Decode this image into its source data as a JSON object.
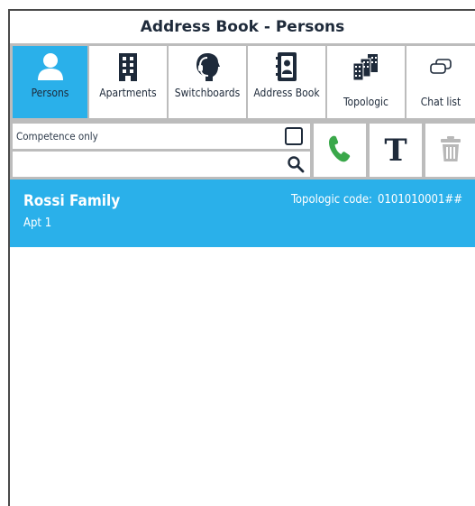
{
  "window": {
    "title": "Address Book - Persons"
  },
  "tabs": [
    {
      "label": "Persons",
      "icon": "person-icon",
      "active": true
    },
    {
      "label": "Apartments",
      "icon": "building-icon",
      "active": false
    },
    {
      "label": "Switchboards",
      "icon": "headset-operator-icon",
      "active": false
    },
    {
      "label": "Address Book",
      "icon": "address-book-icon",
      "active": false
    },
    {
      "label": "Topologic",
      "icon": "buildings-cluster-icon",
      "active": false
    },
    {
      "label": "Chat list",
      "icon": "chat-bubbles-icon",
      "active": false
    }
  ],
  "filter": {
    "competence_label": "Competence only",
    "competence_checked": false
  },
  "search": {
    "value": "",
    "placeholder": ""
  },
  "toolbar": {
    "call_icon": "phone-icon",
    "text_icon": "text-t-icon",
    "text_glyph": "T",
    "delete_icon": "trash-icon"
  },
  "list": {
    "items": [
      {
        "name": "Rossi Family",
        "subtitle": "Apt 1",
        "topo_label": "Topologic code:",
        "topo_code": "0101010001##"
      }
    ]
  },
  "colors": {
    "accent": "#2ab0ea",
    "call_green": "#3aa84a",
    "text_dark": "#1e2a3a",
    "disabled_gray": "#b8b8b8",
    "separator": "#bcbcbc"
  }
}
